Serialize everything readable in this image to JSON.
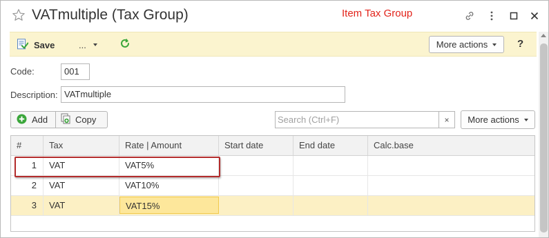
{
  "window": {
    "title": "VATmultiple (Tax Group)",
    "annotation": "Item Tax Group"
  },
  "toolbar": {
    "save_label": "Save",
    "more_small_label": "...",
    "more_actions_label": "More actions",
    "help_label": "?"
  },
  "form": {
    "code_label": "Code:",
    "code_value": "001",
    "description_label": "Description:",
    "description_value": "VATmultiple"
  },
  "table_toolbar": {
    "add_label": "Add",
    "copy_label": "Copy",
    "search_placeholder": "Search (Ctrl+F)",
    "clear_label": "×",
    "more_actions_label": "More actions"
  },
  "table": {
    "columns": [
      "#",
      "Tax",
      "Rate | Amount",
      "Start date",
      "End date",
      "Calc.base"
    ],
    "rows": [
      {
        "num": "1",
        "tax": "VAT",
        "rate": "VAT5%",
        "start": "",
        "end": "",
        "calc": ""
      },
      {
        "num": "2",
        "tax": "VAT",
        "rate": "VAT10%",
        "start": "",
        "end": "",
        "calc": ""
      },
      {
        "num": "3",
        "tax": "VAT",
        "rate": "VAT15%",
        "start": "",
        "end": "",
        "calc": ""
      }
    ],
    "selected_row": 3
  },
  "colors": {
    "toolbar_bg": "#fbf4cf",
    "annotation": "#e2231a",
    "selected_row": "#fcf0c4",
    "active_cell": "#fde79b",
    "highlight_box": "#b32b2b",
    "add_icon": "#3aa63a",
    "refresh_icon": "#3aa63a"
  },
  "icons": {
    "title": "star-icon",
    "link": "link-icon",
    "menu": "more-dots-icon",
    "maximize": "maximize-icon",
    "close": "close-icon",
    "save": "save-document-icon",
    "refresh": "refresh-icon",
    "add": "add-circle-icon",
    "copy": "copy-icon"
  }
}
